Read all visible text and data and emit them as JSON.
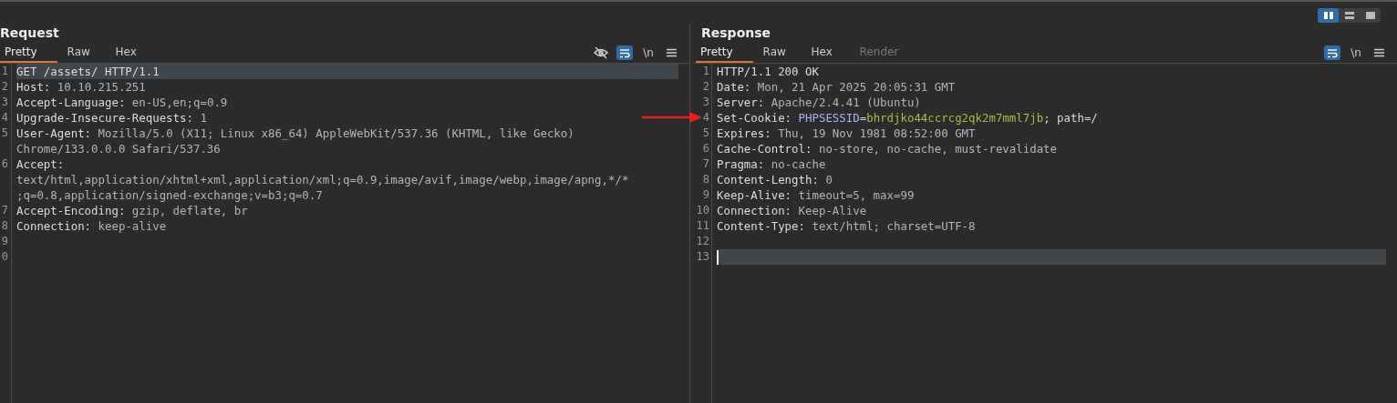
{
  "layout_buttons": [
    {
      "selected": true
    },
    {
      "selected": false
    },
    {
      "selected": false
    }
  ],
  "panes": [
    {
      "title": "Request",
      "tabs": [
        {
          "label": "Pretty",
          "selected": true,
          "disabled": false
        },
        {
          "label": "Raw",
          "selected": false,
          "disabled": false
        },
        {
          "label": "Hex",
          "selected": false,
          "disabled": false
        }
      ],
      "tools": [
        {
          "kind": "eye",
          "selected": false
        },
        {
          "kind": "wrap",
          "selected": true
        },
        {
          "kind": "text",
          "label": "\\n",
          "selected": false
        },
        {
          "kind": "menu",
          "selected": false
        }
      ],
      "lines": [
        {
          "number": "1",
          "key": "GET /assets/ HTTP/1.1",
          "current": true
        },
        {
          "number": "2",
          "key": "Host:",
          "value": "10.10.215.251",
          "current": false
        },
        {
          "number": "3",
          "key": "Accept-Language:",
          "value": "en-US,en;q=0.9",
          "current": false
        },
        {
          "number": "4",
          "key": "Upgrade-Insecure-Requests:",
          "value": "1",
          "current": false
        },
        {
          "number": "5",
          "key": "User-Agent:",
          "value": "Mozilla/5.0 (X11; Linux x86_64) AppleWebKit/537.36 (KHTML, like Gecko)",
          "continuation": [
            "Chrome/133.0.0.0 Safari/537.36"
          ],
          "current": false
        },
        {
          "number": "6",
          "key": "Accept:",
          "continuation": [
            "text/html,application/xhtml+xml,application/xml;q=0.9,image/avif,image/webp,image/apng,*/*",
            ";q=0.8,application/signed-exchange;v=b3;q=0.7"
          ],
          "current": false
        },
        {
          "number": "7",
          "key": "Accept-Encoding:",
          "value": "gzip, deflate, br",
          "current": false
        },
        {
          "number": "8",
          "key": "Connection:",
          "value": "keep-alive",
          "current": false
        },
        {
          "number": "9",
          "current": false
        },
        {
          "number": "0",
          "current": false
        }
      ]
    },
    {
      "title": "Response",
      "tabs": [
        {
          "label": "Pretty",
          "selected": true,
          "disabled": false
        },
        {
          "label": "Raw",
          "selected": false,
          "disabled": false
        },
        {
          "label": "Hex",
          "selected": false,
          "disabled": false
        },
        {
          "label": "Render",
          "selected": false,
          "disabled": true
        }
      ],
      "tools": [
        {
          "kind": "wrap",
          "selected": true
        },
        {
          "kind": "text",
          "label": "\\n",
          "selected": false
        },
        {
          "kind": "menu",
          "selected": false
        }
      ],
      "lines": [
        {
          "number": "1",
          "key": "HTTP/1.1 200 OK",
          "current": false
        },
        {
          "number": "2",
          "key": "Date:",
          "value": "Mon, 21 Apr 2025 20:05:31 GMT",
          "current": false
        },
        {
          "number": "3",
          "key": "Server:",
          "value": "Apache/2.4.41 (Ubuntu)",
          "current": false
        },
        {
          "number": "4",
          "key": "Set-Cookie:",
          "parts": [
            {
              "text": "PHPSESSID",
              "kind": "name"
            },
            {
              "text": "=",
              "kind": "plain"
            },
            {
              "text": "bhrdjko44ccrcg2qk2m7mml7jb",
              "kind": "value"
            },
            {
              "text": "; path=/",
              "kind": "plain"
            }
          ],
          "current": false,
          "arrow": true
        },
        {
          "number": "5",
          "key": "Expires:",
          "value": "Thu, 19 Nov 1981 08:52:00 GMT",
          "current": false
        },
        {
          "number": "6",
          "key": "Cache-Control:",
          "value": "no-store, no-cache, must-revalidate",
          "current": false
        },
        {
          "number": "7",
          "key": "Pragma:",
          "value": "no-cache",
          "current": false
        },
        {
          "number": "8",
          "key": "Content-Length:",
          "value": "0",
          "current": false
        },
        {
          "number": "9",
          "key": "Keep-Alive:",
          "value": "timeout=5, max=99",
          "current": false
        },
        {
          "number": "10",
          "key": "Connection:",
          "value": "Keep-Alive",
          "current": false
        },
        {
          "number": "11",
          "key": "Content-Type:",
          "value": "text/html; charset=UTF-8",
          "current": false
        },
        {
          "number": "12",
          "current": false
        },
        {
          "number": "13",
          "current": true,
          "cursor": true
        }
      ]
    }
  ]
}
